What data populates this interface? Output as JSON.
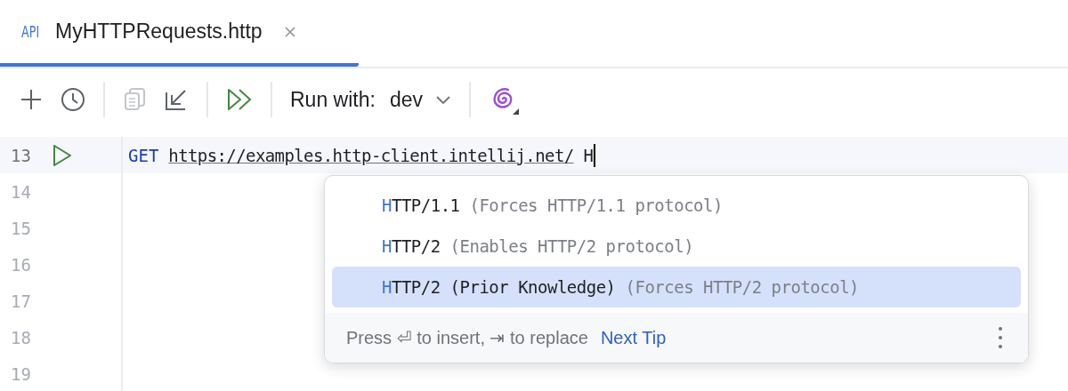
{
  "tabs": [
    {
      "badge": "API",
      "label": "MyHTTPRequests.http",
      "selected": true
    }
  ],
  "toolbar": {
    "run_with_label": "Run with:",
    "environment": "dev"
  },
  "editor": {
    "lines": [
      {
        "number": "13",
        "current": true,
        "runnable": true,
        "method": "GET",
        "url": "https://examples.http-client.intellij.net/",
        "typed": "H"
      },
      {
        "number": "14",
        "current": false,
        "runnable": false
      },
      {
        "number": "15",
        "current": false,
        "runnable": false
      },
      {
        "number": "16",
        "current": false,
        "runnable": false
      },
      {
        "number": "17",
        "current": false,
        "runnable": false
      },
      {
        "number": "18",
        "current": false,
        "runnable": false
      },
      {
        "number": "19",
        "current": false,
        "runnable": false
      }
    ]
  },
  "completion": {
    "items": [
      {
        "match": "H",
        "rest": "TTP/1.1",
        "hint": "(Forces HTTP/1.1 protocol)",
        "selected": false
      },
      {
        "match": "H",
        "rest": "TTP/2",
        "hint": "(Enables HTTP/2 protocol)",
        "selected": false
      },
      {
        "match": "H",
        "rest": "TTP/2 (Prior Knowledge)",
        "hint": "(Forces HTTP/2 protocol)",
        "selected": true
      }
    ],
    "footer_text": "Press ⏎ to insert, ⇥ to replace",
    "tip_link": "Next Tip"
  }
}
